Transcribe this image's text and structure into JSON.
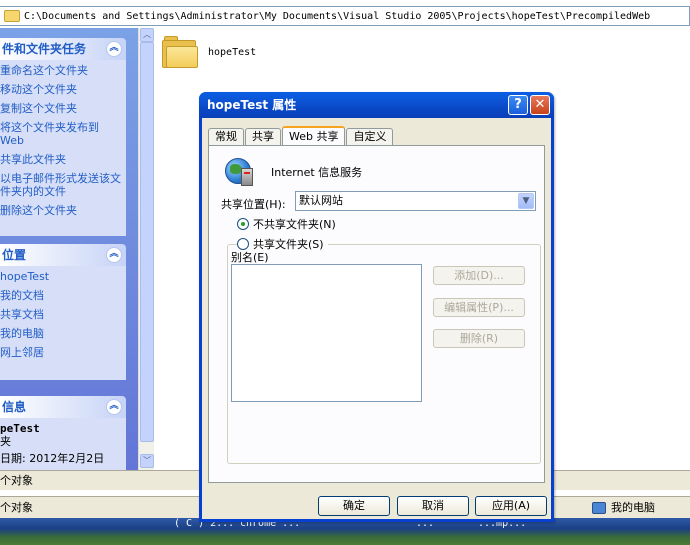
{
  "explorer": {
    "address_path": "C:\\Documents and Settings\\Administrator\\My Documents\\Visual Studio 2005\\Projects\\hopeTest\\PrecompiledWeb",
    "folder_name": "hopeTest",
    "task_panel": {
      "title": "件和文件夹任务",
      "items": [
        "重命名这个文件夹",
        "移动这个文件夹",
        "复制这个文件夹",
        "将这个文件夹发布到 Web",
        "共享此文件夹",
        "以电子邮件形式发送该文件夹内的文件",
        "删除这个文件夹"
      ]
    },
    "places_panel": {
      "title": "位置",
      "items": [
        "hopeTest",
        "我的文档",
        "共享文档",
        "我的电脑",
        "网上邻居"
      ]
    },
    "details_panel": {
      "title": "信息",
      "name": "peTest",
      "type": "夹",
      "date": "日期: 2012年2月2日"
    },
    "status_objects": "个对象",
    "status_objects2": "个对象",
    "status_computer": "我的电脑",
    "taskbar_texts": [
      "( C ) 2...",
      "chrome ...",
      "...",
      "...mp..."
    ]
  },
  "dialog": {
    "title": "hopeTest 属性",
    "tabs": [
      "常规",
      "共享",
      "Web 共享",
      "自定义"
    ],
    "active_tab": "Web 共享",
    "service_label": "Internet 信息服务",
    "share_location_label": "共享位置(H):",
    "share_location_value": "默认网站",
    "radio_no_share": "不共享文件夹(N)",
    "radio_share": "共享文件夹(S)",
    "radio_selected": "no_share",
    "alias_label": "别名(E)",
    "side_buttons": [
      "添加(D)...",
      "编辑属性(P)...",
      "删除(R)"
    ],
    "buttons": {
      "ok": "确定",
      "cancel": "取消",
      "apply": "应用(A)"
    }
  }
}
